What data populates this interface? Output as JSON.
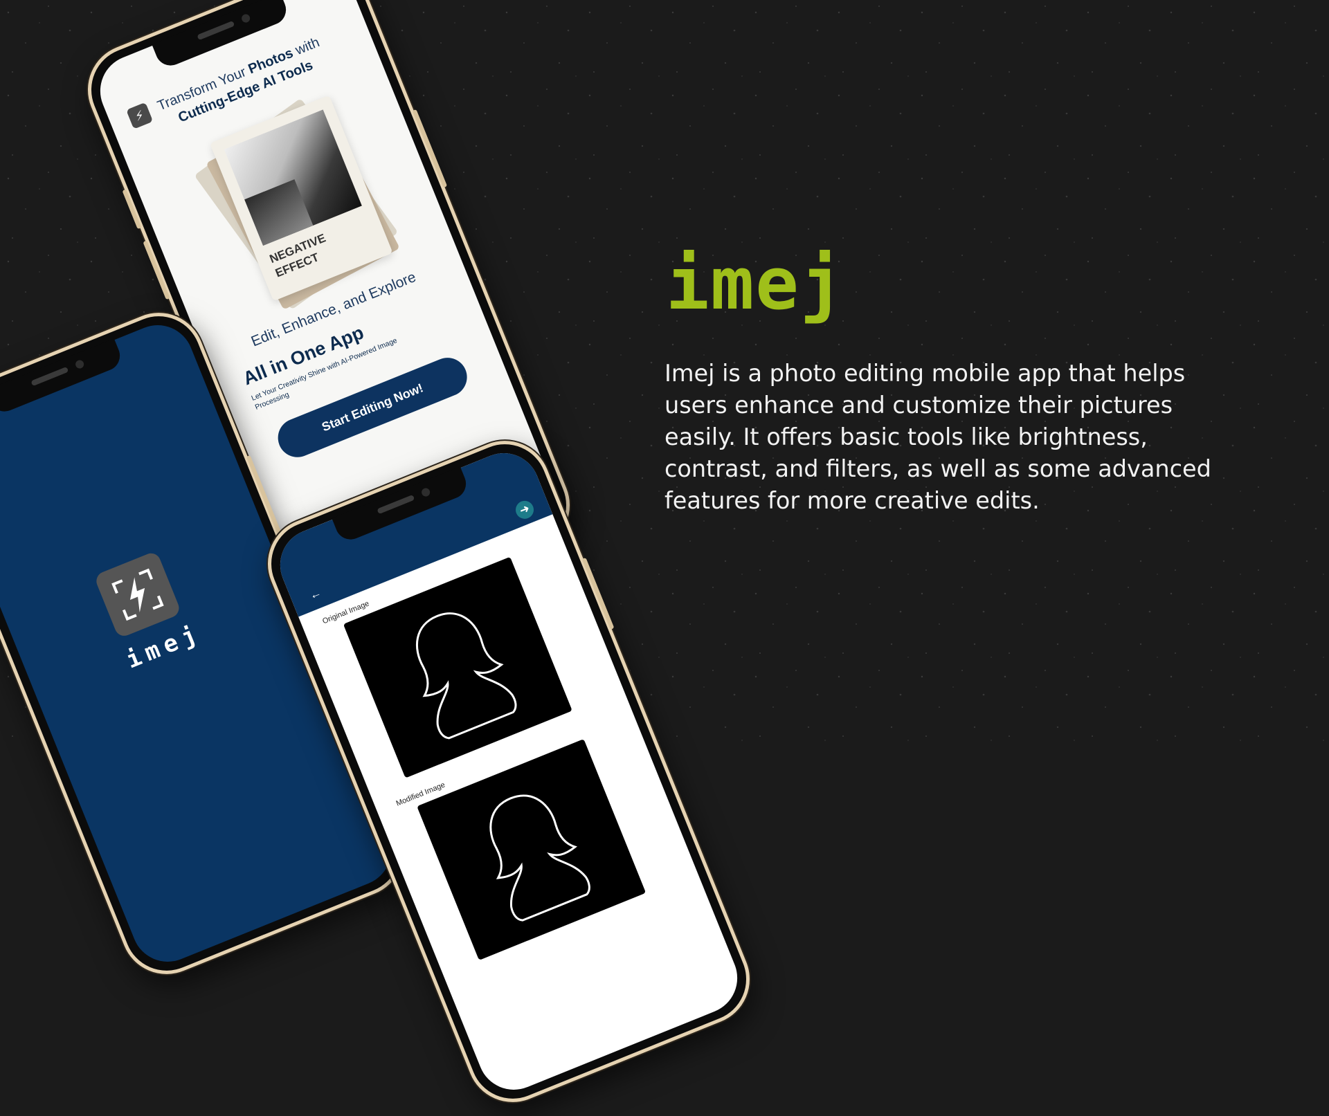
{
  "colors": {
    "background": "#1b1b1b",
    "brand_green": "#9fbf1a",
    "navy": "#0a3563",
    "phone_frame": "#e6d3b2"
  },
  "brand": {
    "name": "imej",
    "description": "Imej is a photo editing mobile app that helps users enhance and customize their pictures easily. It offers basic tools like brightness, contrast, and filters, as well as some advanced features for more creative edits."
  },
  "welcome_screen": {
    "title_part1": "Transform Your ",
    "title_bold1": "Photos",
    "title_part2": " with",
    "title_bold2": "Cutting-Edge AI Tools",
    "card_caption_line1": "NEGATIVE",
    "card_caption_line2": "EFFECT",
    "subtitle": "Edit, Enhance, and Explore",
    "app_headline": "All in One App",
    "tagline": "Let Your Creativity Shine with AI-Powered Image Processing",
    "start_button": "Start Editing Now!",
    "logo_icon": "bolt-icon"
  },
  "splash_screen": {
    "app_name": "imej",
    "logo_icon": "bolt-frame-icon"
  },
  "editor_screen": {
    "original_label": "Original Image",
    "modified_label": "Modified Image",
    "back_icon": "arrow-left-icon",
    "next_icon": "arrow-right-icon"
  }
}
